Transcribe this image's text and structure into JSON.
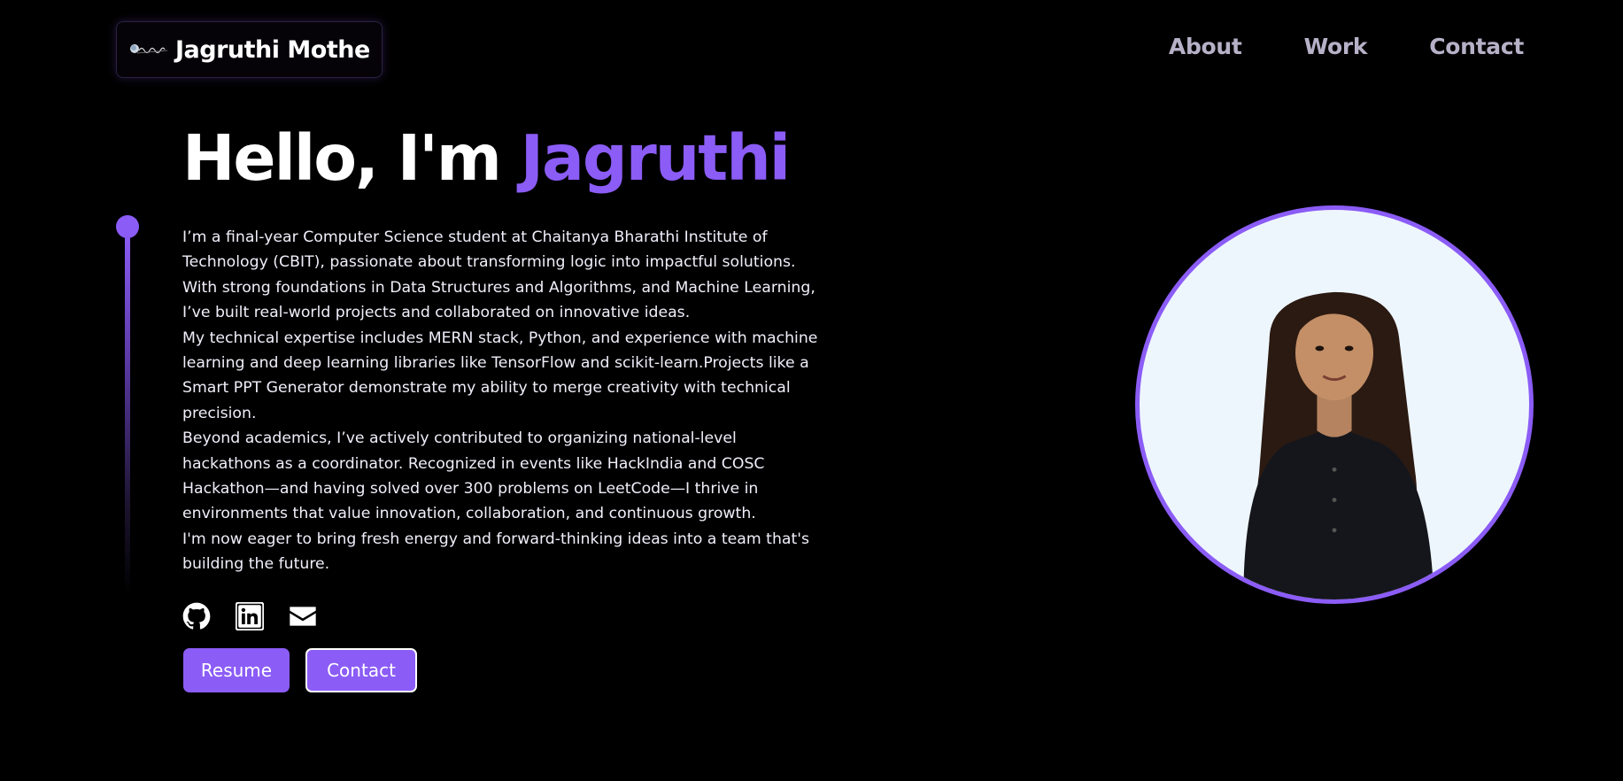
{
  "header": {
    "brand_name": "Jagruthi Mothe",
    "logo_icon": "signature-logo-icon",
    "nav": [
      {
        "label": "About"
      },
      {
        "label": "Work"
      },
      {
        "label": "Contact"
      }
    ]
  },
  "hero": {
    "greeting": "Hello, I'm ",
    "name": "Jagruthi",
    "bio": [
      "I’m a final-year Computer Science student at Chaitanya Bharathi Institute of Technology (CBIT), passionate about transforming logic into impactful solutions. With strong foundations in Data Structures and Algorithms, and Machine Learning, I’ve built real-world projects and collaborated on innovative ideas.",
      "My technical expertise includes MERN stack, Python, and experience with machine learning and deep learning libraries like TensorFlow and scikit-learn.Projects like a Smart PPT Generator demonstrate my ability to merge creativity with technical precision.",
      "Beyond academics, I’ve actively contributed to organizing national-level hackathons as a coordinator. Recognized in events like HackIndia and COSC Hackathon—and having solved over 300 problems on LeetCode—I thrive in environments that value innovation, collaboration, and continuous growth.",
      "I'm now eager to bring fresh energy and forward-thinking ideas into a team that's building the future."
    ],
    "socials": [
      {
        "icon": "github-icon"
      },
      {
        "icon": "linkedin-icon"
      },
      {
        "icon": "mail-icon"
      }
    ],
    "buttons": {
      "resume": "Resume",
      "contact": "Contact"
    }
  },
  "colors": {
    "accent": "#8b5cf6",
    "background": "#000000",
    "nav_text": "#b7b1c8",
    "photo_bg": "#eef6fd"
  }
}
